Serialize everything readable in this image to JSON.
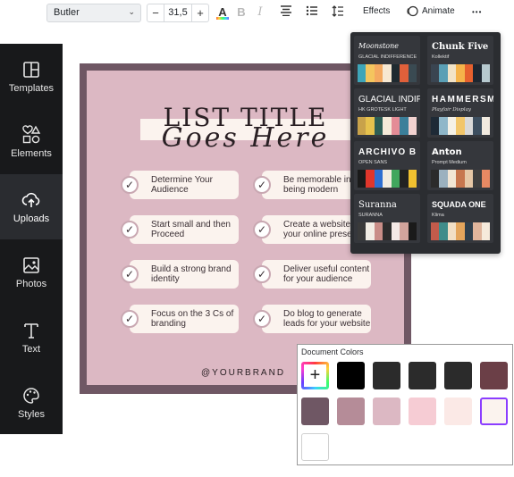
{
  "toolbar": {
    "font_name": "Butler",
    "font_size": "31,5",
    "minus": "−",
    "plus": "+",
    "text_color_icon": "A",
    "bold": "B",
    "italic": "I",
    "effects_label": "Effects",
    "animate_label": "Animate",
    "more": "•••"
  },
  "sidebar": {
    "items": [
      {
        "label": "Templates",
        "icon": "templates-icon"
      },
      {
        "label": "Elements",
        "icon": "elements-icon"
      },
      {
        "label": "Uploads",
        "icon": "uploads-icon"
      },
      {
        "label": "Photos",
        "icon": "photos-icon"
      },
      {
        "label": "Text",
        "icon": "text-icon"
      },
      {
        "label": "Styles",
        "icon": "styles-icon"
      }
    ]
  },
  "design": {
    "title_line1": "LIST TITLE",
    "title_line2": "Goes Here",
    "items": [
      "Determine Your Audience",
      "Be memorable in of being modern",
      "Start small and then Proceed",
      "Create a website to your online prese",
      "Build a strong brand identity",
      "Deliver useful content for your audience",
      "Focus on the 3 Cs of branding",
      "Do blog to generate leads for your website"
    ],
    "brand": "@YOURBRAND",
    "check_glyph": "✓"
  },
  "font_panel": {
    "cards": [
      {
        "name": "Moonstone",
        "sub": "GLACIAL INDIFFERENCE",
        "colors": [
          "#3ea5b8",
          "#f4c55e",
          "#f4a960",
          "#f7e8d2",
          "#1f2a30",
          "#e0603a",
          "#3a4a52"
        ]
      },
      {
        "name": "Chunk Five",
        "sub": "Kollektif",
        "colors": [
          "#3a4551",
          "#5a9fb5",
          "#f2e3c6",
          "#f5b34a",
          "#e5602e",
          "#1d2630",
          "#b6c9cf"
        ]
      },
      {
        "name": "GLACIAL INDIF",
        "sub": "HK GROTESK LIGHT",
        "colors": [
          "#c8a24a",
          "#e6c24d",
          "#2d5e55",
          "#f5ead8",
          "#e48c96",
          "#3b7f9a",
          "#f2d2d0"
        ]
      },
      {
        "name": "HAMMERSM",
        "sub": "Playfair Display",
        "colors": [
          "#1e2a36",
          "#8fb7c9",
          "#f5f1e6",
          "#f2c66a",
          "#d9d9d9",
          "#3d4f60",
          "#f2ebe0"
        ]
      },
      {
        "name": "ARCHIVO B",
        "sub": "OPEN SANS",
        "colors": [
          "#1a1a1a",
          "#e0362b",
          "#2e6fd1",
          "#f3ece0",
          "#41a65d",
          "#222222",
          "#f2c230"
        ]
      },
      {
        "name": "Anton",
        "sub": "Prompt Medium",
        "colors": [
          "#2b2b2b",
          "#9bb1bf",
          "#f2e6d5",
          "#c7764e",
          "#e6c7a6",
          "#3f3f3f",
          "#e88963"
        ]
      },
      {
        "name": "Suranna",
        "sub": "SURANNA",
        "colors": [
          "#3a3a3a",
          "#f2ede4",
          "#c98d87",
          "#2c2c2c",
          "#f4e9e6",
          "#d2a49c",
          "#1a1a1a"
        ]
      },
      {
        "name": "SQUADA ONE",
        "sub": "Klima",
        "colors": [
          "#c25b4b",
          "#3f8c8a",
          "#f2dfc5",
          "#e4a55c",
          "#2f3e4b",
          "#e0b59c",
          "#f6eadb"
        ]
      }
    ]
  },
  "doc_colors": {
    "header": "Document Colors",
    "add_glyph": "+",
    "swatches": [
      "#000000",
      "#2b2b2b",
      "#2b2b2b",
      "#2b2b2b",
      "#6b3f47",
      "#6f5764",
      "#b58c98",
      "#dcb8c3",
      "#f6ccd4",
      "#fbe9e6",
      "#fbf3ee",
      "#ffffff"
    ]
  }
}
